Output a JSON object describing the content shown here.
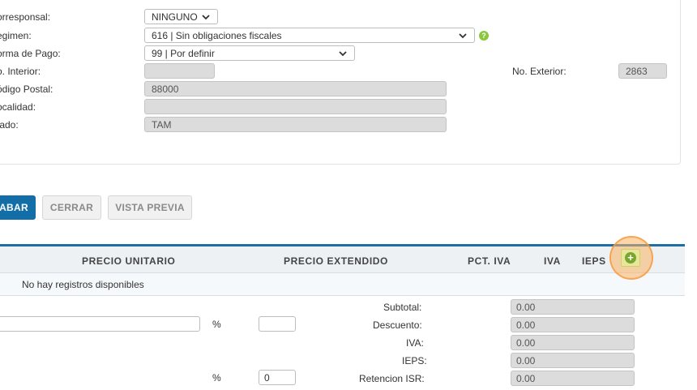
{
  "form": {
    "corresponsal_label": "orresponsal:",
    "corresponsal_value": "NINGUNO",
    "regimen_label": "egimen:",
    "regimen_value": "616 | Sin obligaciones fiscales",
    "forma_pago_label": "orma de Pago:",
    "forma_pago_value": "99 | Por definir",
    "no_interior_label": "o. Interior:",
    "no_interior_value": "",
    "no_exterior_label": "No. Exterior:",
    "no_exterior_value": "2863",
    "codigo_postal_label": "ódigo Postal:",
    "codigo_postal_value": "88000",
    "localidad_label": "ocalidad:",
    "localidad_value": "",
    "estado_label": "tado:",
    "estado_value": "TAM"
  },
  "actions": {
    "grabar": "ABAR",
    "cerrar": "CERRAR",
    "vista_previa": "VISTA PREVIA"
  },
  "grid": {
    "columns": [
      "PRECIO UNITARIO",
      "PRECIO EXTENDIDO",
      "PCT. IVA",
      "IVA",
      "IEPS"
    ],
    "empty_message": "No hay registros disponibles",
    "add_icon": "plus-circle-icon"
  },
  "totals": {
    "percent_symbol": "%",
    "percent_symbol_2": "%",
    "descuento_input": "",
    "retencion_input": "0",
    "subtotal_label": "Subtotal:",
    "subtotal_value": "0.00",
    "descuento_label": "Descuento:",
    "descuento_value": "0.00",
    "iva_label": "IVA:",
    "iva_value": "0.00",
    "ieps_label": "IEPS:",
    "ieps_value": "0.00",
    "retencion_isr_label": "Retencion ISR:",
    "retencion_isr_value": "0.00"
  },
  "colors": {
    "primary": "#136ea8",
    "help": "#8cc63f",
    "highlight": "#f79637"
  }
}
